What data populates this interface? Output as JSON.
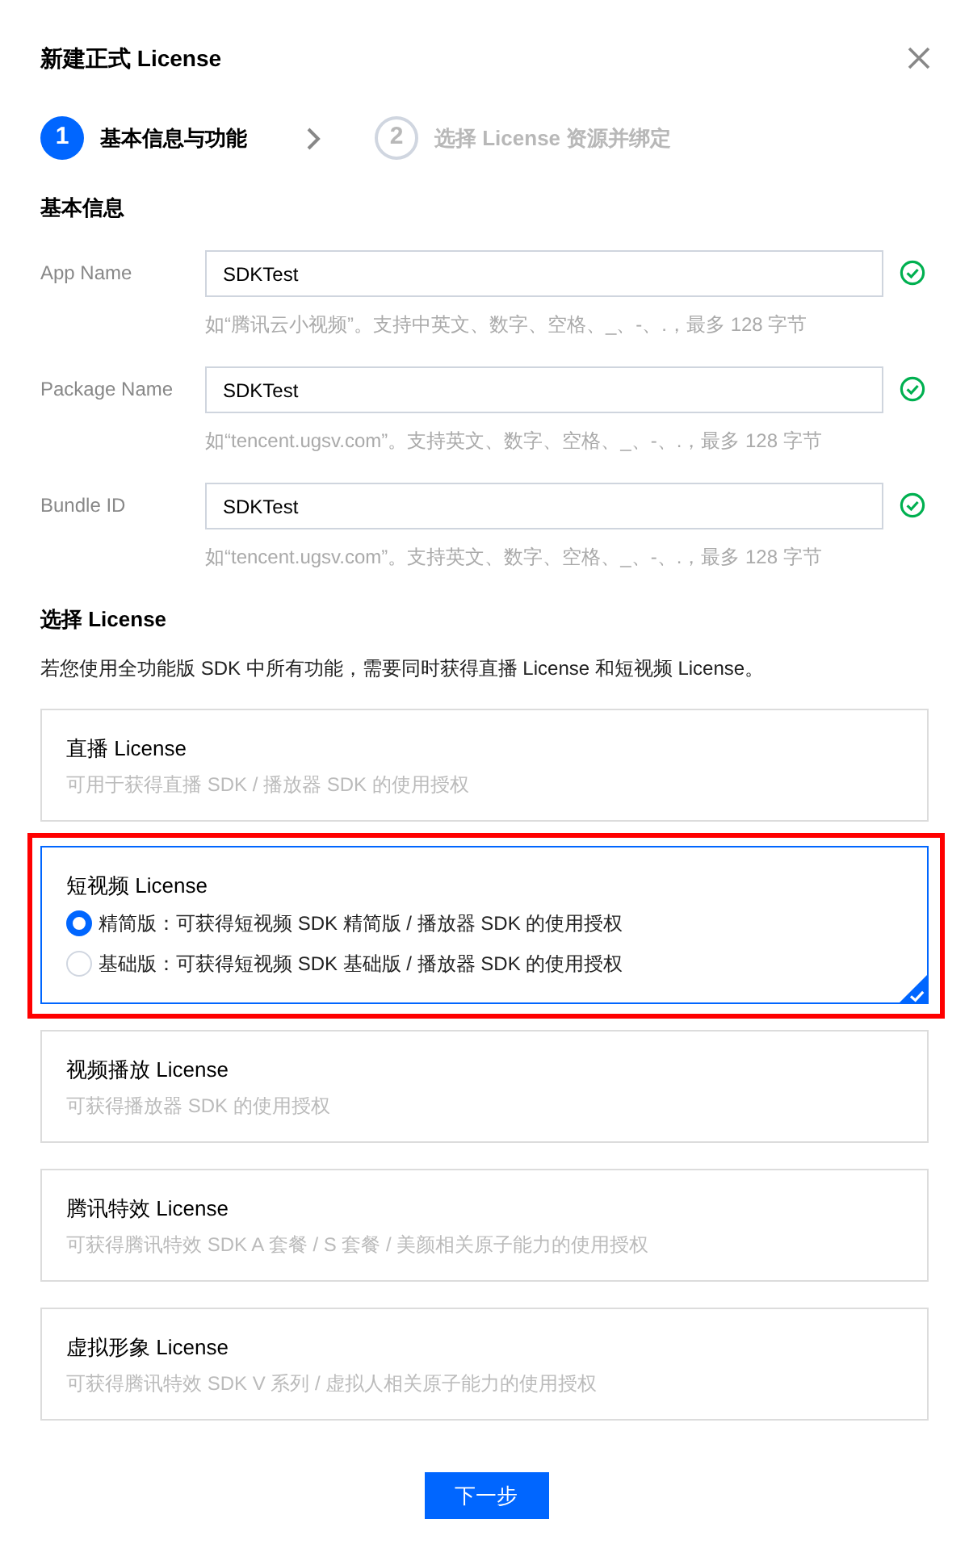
{
  "dialog": {
    "title": "新建正式 License"
  },
  "steps": [
    {
      "number": "1",
      "label": "基本信息与功能",
      "selected": true
    },
    {
      "number": "2",
      "label": "选择 License 资源并绑定",
      "selected": false
    }
  ],
  "basic_info": {
    "heading": "基本信息",
    "fields": [
      {
        "label": "App Name",
        "value": "SDKTest",
        "hint": "如“腾讯云小视频”。支持中英文、数字、空格、_、-、.，最多 128 字节",
        "valid": true
      },
      {
        "label": "Package Name",
        "value": "SDKTest",
        "hint": "如“tencent.ugsv.com”。支持英文、数字、空格、_、-、.，最多 128 字节",
        "valid": true
      },
      {
        "label": "Bundle ID",
        "value": "SDKTest",
        "hint": "如“tencent.ugsv.com”。支持英文、数字、空格、_、-、.，最多 128 字节",
        "valid": true
      }
    ]
  },
  "license_section": {
    "heading": "选择 License",
    "description": "若您使用全功能版 SDK 中所有功能，需要同时获得直播 License 和短视频 License。",
    "options": [
      {
        "kind": "simple",
        "title": "直播 License",
        "description": "可用于获得直播 SDK / 播放器 SDK 的使用授权",
        "selected": false,
        "highlighted": false
      },
      {
        "kind": "editions",
        "title": "短视频 License",
        "selected": true,
        "highlighted": true,
        "editions": [
          {
            "label": "精简版：可获得短视频 SDK 精简版 / 播放器 SDK 的使用授权",
            "selected": true
          },
          {
            "label": "基础版：可获得短视频 SDK 基础版 / 播放器 SDK 的使用授权",
            "selected": false
          }
        ]
      },
      {
        "kind": "simple",
        "title": "视频播放 License",
        "description": "可获得播放器 SDK 的使用授权",
        "selected": false,
        "highlighted": false
      },
      {
        "kind": "simple",
        "title": "腾讯特效 License",
        "description": "可获得腾讯特效 SDK A 套餐 / S 套餐 / 美颜相关原子能力的使用授权",
        "selected": false,
        "highlighted": false
      },
      {
        "kind": "simple",
        "title": "虚拟形象 License",
        "description": "可获得腾讯特效 SDK V 系列 / 虚拟人相关原子能力的使用授权",
        "selected": false,
        "highlighted": false
      }
    ]
  },
  "next_button": {
    "label": "下一步"
  }
}
